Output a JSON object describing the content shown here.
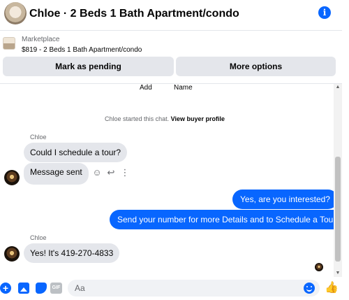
{
  "header": {
    "title": "Chloe · 2 Beds 1 Bath Apartment/condo",
    "info_icon": "i"
  },
  "listing": {
    "category": "Marketplace",
    "price_title": "$819 - 2 Beds 1 Bath Apartment/condo",
    "pending_label": "Mark as pending",
    "more_label": "More options"
  },
  "chat": {
    "top_labels": {
      "add": "Add",
      "name": "Name"
    },
    "started_text": "Chloe started this chat.",
    "view_profile": "View buyer profile",
    "messages": [
      {
        "sender": "Chloe",
        "text": "Could I schedule a tour?"
      },
      {
        "text": "Message sent"
      },
      {
        "text": "Yes, are you interested?"
      },
      {
        "text": "Send your number for more Details and to Schedule a Tour."
      },
      {
        "sender": "Chloe",
        "text": "Yes! It's 419-270-4833"
      }
    ]
  },
  "composer": {
    "placeholder": "Aa",
    "gif_label": "GIF"
  },
  "colors": {
    "accent": "#0866ff",
    "incoming_bubble": "#e4e6eb",
    "secondary_text": "#65676b"
  }
}
